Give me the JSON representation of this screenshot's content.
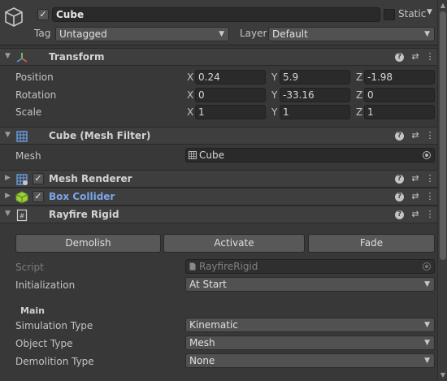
{
  "object": {
    "name": "Cube",
    "active": true,
    "static_label": "Static",
    "static": false,
    "tag_label": "Tag",
    "tag_value": "Untagged",
    "layer_label": "Layer",
    "layer_value": "Default"
  },
  "transform": {
    "title": "Transform",
    "position_label": "Position",
    "rotation_label": "Rotation",
    "scale_label": "Scale",
    "axis_x": "X",
    "axis_y": "Y",
    "axis_z": "Z",
    "position": {
      "x": "0.24",
      "y": "5.9",
      "z": "-1.98"
    },
    "rotation": {
      "x": "0",
      "y": "-33.16",
      "z": "0"
    },
    "scale": {
      "x": "1",
      "y": "1",
      "z": "1"
    }
  },
  "mesh_filter": {
    "title": "Cube (Mesh Filter)",
    "mesh_label": "Mesh",
    "mesh_value": "Cube"
  },
  "mesh_renderer": {
    "title": "Mesh Renderer",
    "enabled": true
  },
  "box_collider": {
    "title": "Box Collider",
    "enabled": true
  },
  "rayfire": {
    "title": "Rayfire Rigid",
    "buttons": {
      "demolish": "Demolish",
      "activate": "Activate",
      "fade": "Fade"
    },
    "script_label": "Script",
    "script_value": "RayfireRigid",
    "initialization_label": "Initialization",
    "initialization_value": "At Start",
    "main_title": "Main",
    "simulation_type_label": "Simulation Type",
    "simulation_type_value": "Kinematic",
    "object_type_label": "Object Type",
    "object_type_value": "Mesh",
    "demolition_type_label": "Demolition Type",
    "demolition_type_value": "None"
  },
  "icons": {
    "help": "?",
    "presets": "⇄",
    "menu": "⋮",
    "fold_open": "▼",
    "fold_closed": "▶",
    "dropdown": "▼",
    "check": "✓"
  },
  "colors": {
    "background": "#383838",
    "header": "#3e3e3e",
    "field": "#2a2a2a",
    "link": "#7aa7e8",
    "accent_green": "#9bd03c"
  }
}
